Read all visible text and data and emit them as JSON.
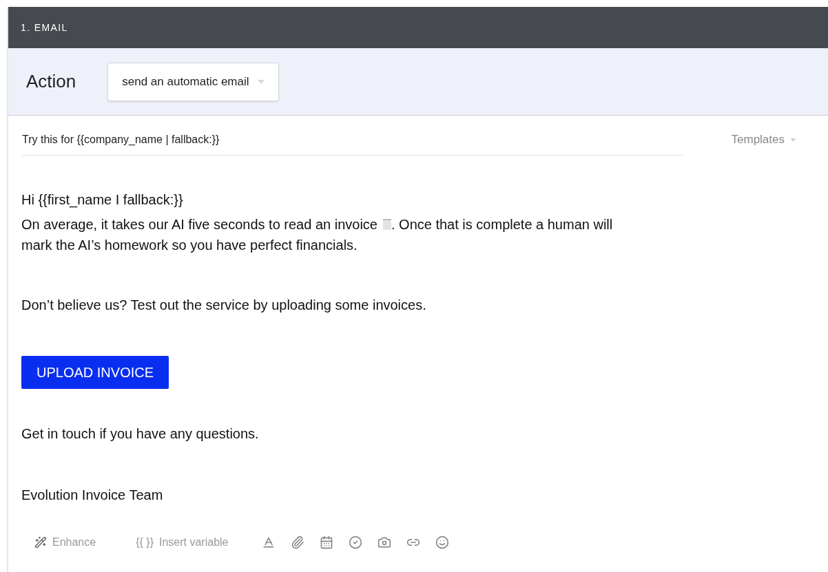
{
  "section": {
    "title": "1. EMAIL"
  },
  "action": {
    "label": "Action",
    "value": "send an automatic email"
  },
  "subject": {
    "value": "Try this for {{company_name | fallback:}}",
    "templates": "Templates"
  },
  "body": {
    "greeting": "Hi {{first_name I fallback:}}",
    "paragraph_before_icon": "On average, it takes our AI five seconds to read an invoice",
    "paragraph_after_icon": ". Once that is complete a human will",
    "paragraph_second_line": "mark the AI’s homework so you have perfect financials.",
    "prompt": "Don’t believe us? Test out the service by uploading some invoices.",
    "button": "UPLOAD INVOICE",
    "closing": "Get in touch if you have any questions.",
    "signature": "Evolution Invoice Team"
  },
  "toolbar": {
    "enhance": "Enhance",
    "variable_glyph": "{{ }}",
    "insert_variable": "Insert variable"
  }
}
